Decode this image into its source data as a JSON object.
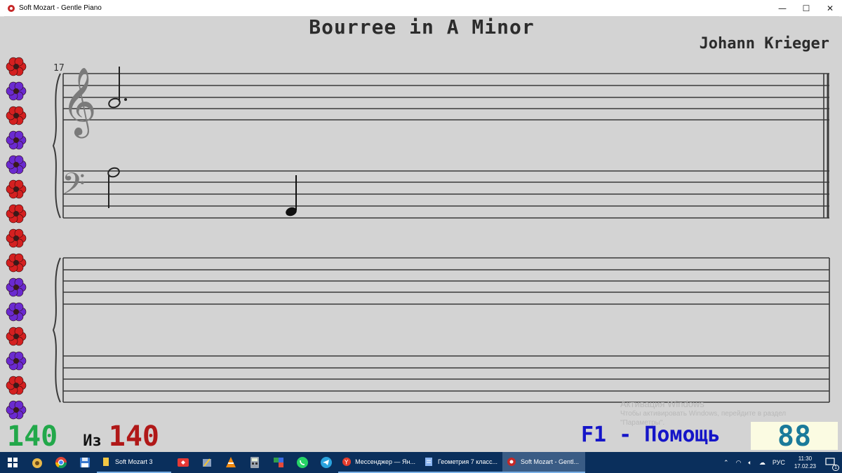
{
  "window": {
    "title": "Soft Mozart - Gentle Piano",
    "controls": {
      "minimize": "—",
      "maximize": "☐",
      "close": "✕"
    }
  },
  "piece": {
    "title": "Bourree in A Minor",
    "composer": "Johann Krieger",
    "measure_number": "17"
  },
  "counter": {
    "current": "140",
    "of_label": "Из",
    "total": "140"
  },
  "help_label": "F1 - Помощь",
  "score_value": "88",
  "watermark": {
    "title": "Активация Windows",
    "line1": "Чтобы активировать Windows, перейдите в раздел",
    "line2": "\"Параметры\"."
  },
  "flowers": [
    "red",
    "purple",
    "red",
    "purple",
    "purple",
    "red",
    "red",
    "red",
    "red",
    "purple",
    "purple",
    "red",
    "purple",
    "red",
    "purple"
  ],
  "colors": {
    "flower_red": "#d42020",
    "flower_purple": "#6a2ad0",
    "counter_green": "#22a84a",
    "counter_red": "#b01818",
    "help_blue": "#1515c8",
    "score_teal": "#1a7a9a"
  },
  "taskbar": {
    "apps": [
      {
        "label": "Soft Mozart 3",
        "icon": "folder-icon",
        "active": false
      },
      {
        "label": "Мессенджер — Ян...",
        "icon": "yandex-icon",
        "active": false
      },
      {
        "label": "Геометрия 7 класс...",
        "icon": "document-icon",
        "active": false
      },
      {
        "label": "Soft Mozart - Gentl...",
        "icon": "soft-mozart-icon",
        "active": true
      }
    ],
    "tray": {
      "language": "РУС",
      "time": "11:30",
      "date": "17.02.23",
      "notifications": "1"
    }
  }
}
